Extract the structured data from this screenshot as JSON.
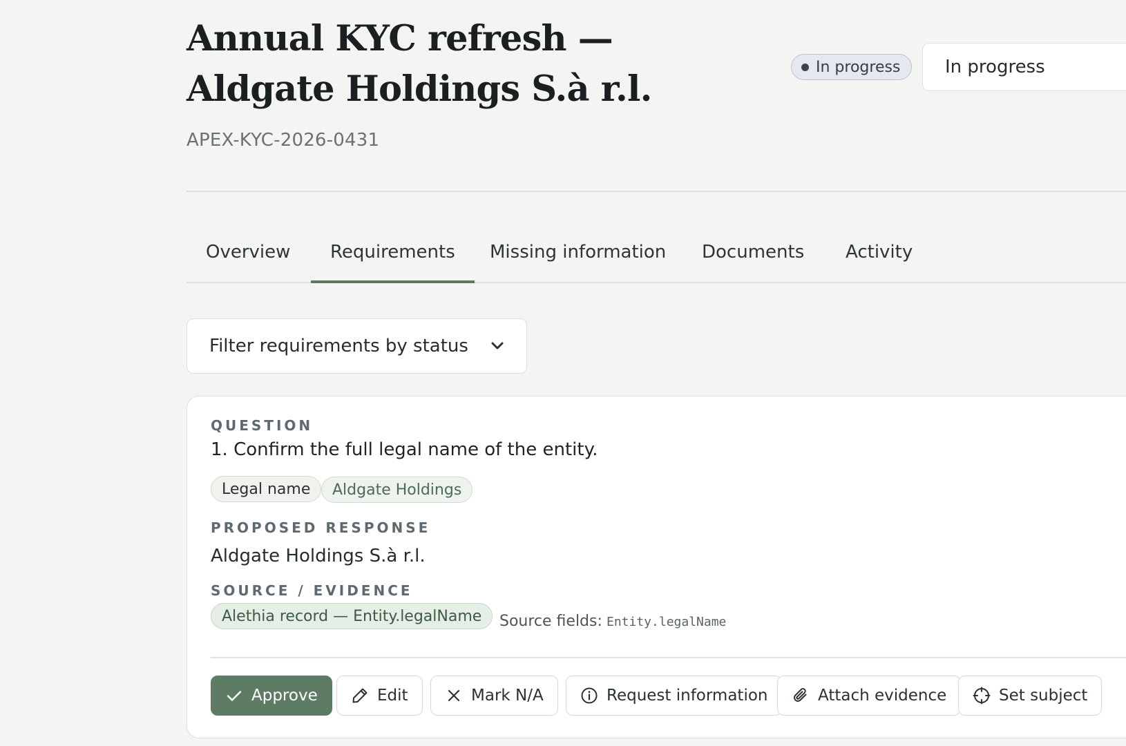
{
  "header": {
    "title": "Annual KYC refresh — Aldgate Holdings S.à r.l.",
    "case_id": "APEX-KYC-2026-0431",
    "status_badge": "In progress",
    "status_select_value": "In progress"
  },
  "tabs": [
    {
      "label": "Overview",
      "active": false
    },
    {
      "label": "Requirements",
      "active": true
    },
    {
      "label": "Missing information",
      "active": false
    },
    {
      "label": "Documents",
      "active": false
    },
    {
      "label": "Activity",
      "active": false
    }
  ],
  "filter": {
    "value": "Filter requirements by status"
  },
  "requirement": {
    "question_label": "QUESTION",
    "question_text": "1. Confirm the full legal name of the entity.",
    "tags": [
      "Legal name",
      "Aldgate Holdings"
    ],
    "response_label": "PROPOSED RESPONSE",
    "response_text": "Aldgate Holdings S.à r.l.",
    "source_label": "SOURCE / EVIDENCE",
    "source_chip": "Alethia record — Entity.legalName",
    "source_fields_label": "Source fields:",
    "source_fields_code": "Entity.legalName",
    "actions": {
      "approve": "Approve",
      "edit": "Edit",
      "mark_na": "Mark N/A",
      "request_info": "Request information",
      "attach_evidence": "Attach evidence",
      "set_subject": "Set subject"
    }
  },
  "icons": {
    "status_dot": "status-dot-icon",
    "filter_chevron": "chevron-down-icon",
    "approve": "check-icon",
    "edit": "pencil-icon",
    "mark_na": "x-icon",
    "request_info": "info-icon",
    "attach_evidence": "paperclip-icon",
    "set_subject": "crosshair-icon"
  },
  "colors": {
    "background": "#f4f4f2",
    "accent_green": "#5e7c64",
    "status_badge_bg": "#e4e9ef",
    "chip_green_bg": "#eef3ee"
  }
}
